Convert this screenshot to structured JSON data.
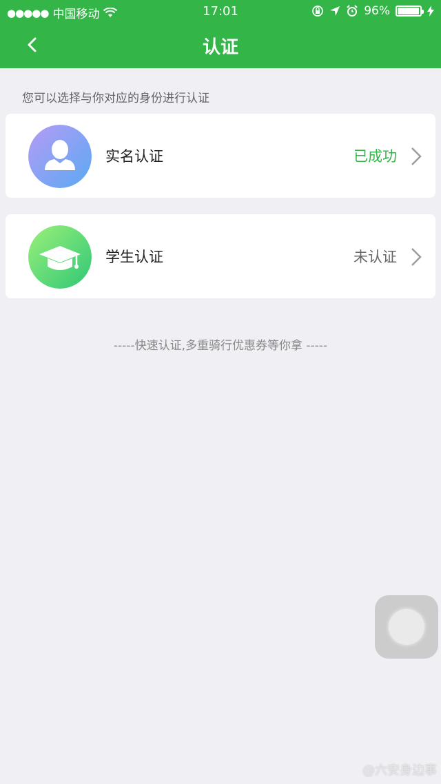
{
  "status_bar": {
    "signal": "●●●●●",
    "carrier": "中国移动",
    "time": "17:01",
    "battery": "96%"
  },
  "nav": {
    "title": "认证"
  },
  "hint": "您可以选择与你对应的身份进行认证",
  "items": [
    {
      "label": "实名认证",
      "state": "已成功",
      "state_color": "#34b548",
      "icon": "person-icon"
    },
    {
      "label": "学生认证",
      "state": "未认证",
      "state_color": "#666666",
      "icon": "graduation-cap-icon"
    }
  ],
  "footer_tip": "-----快速认证,多重骑行优惠券等你拿 -----",
  "watermark": "@六安身边事",
  "colors": {
    "brand_green": "#34b548",
    "background": "#efeff4"
  }
}
